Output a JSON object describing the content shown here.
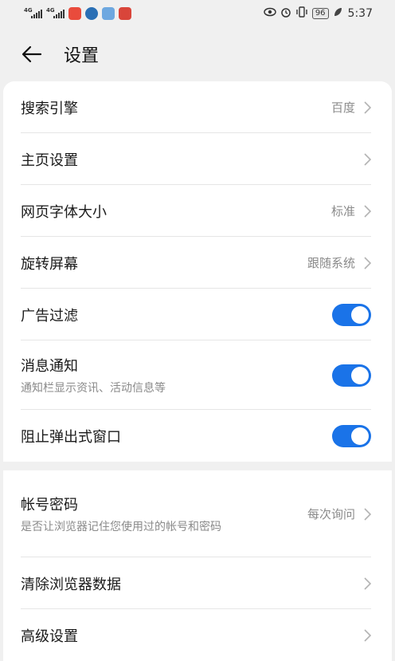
{
  "status_bar": {
    "network1": "4G",
    "network2": "4G",
    "battery": "96",
    "time": "5:37"
  },
  "header": {
    "title": "设置"
  },
  "settings_group1": [
    {
      "label": "搜索引擎",
      "value": "百度"
    },
    {
      "label": "主页设置",
      "value": ""
    },
    {
      "label": "网页字体大小",
      "value": "标准"
    },
    {
      "label": "旋转屏幕",
      "value": "跟随系统"
    },
    {
      "label": "广告过滤",
      "toggle": true
    },
    {
      "label": "消息通知",
      "sub": "通知栏显示资讯、活动信息等",
      "toggle": true
    },
    {
      "label": "阻止弹出式窗口",
      "toggle": true
    }
  ],
  "settings_group2": [
    {
      "label": "帐号密码",
      "sub": "是否让浏览器记住您使用过的帐号和密码",
      "value": "每次询问"
    },
    {
      "label": "清除浏览器数据",
      "value": ""
    },
    {
      "label": "高级设置",
      "value": ""
    }
  ],
  "colors": {
    "toggle_on": "#1a73e8",
    "background": "#f0f0f0"
  }
}
